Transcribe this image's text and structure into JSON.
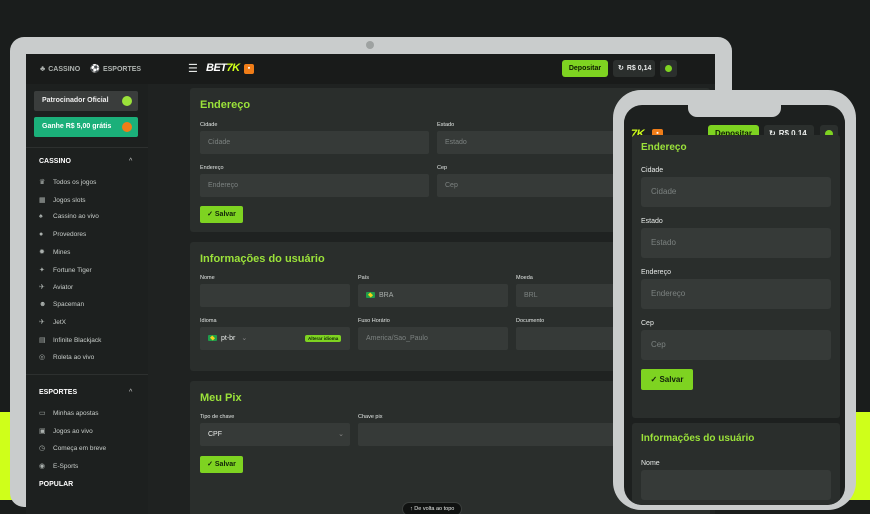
{
  "topbar": {
    "casino": "CASSINO",
    "esportes": "ESPORTES",
    "logo_main": "BET",
    "logo_accent": "7K",
    "deposit_label": "Depositar",
    "balance": "R$ 0,14"
  },
  "sidebar": {
    "promo_sponsor": "Patrocinador Oficial",
    "promo_bonus": "Ganhe R$ 5,00 grátis",
    "casino_header": "CASSINO",
    "casino_items": [
      "Todos os jogos",
      "Jogos slots",
      "Cassino ao vivo",
      "Provedores",
      "Mines",
      "Fortune Tiger",
      "Aviator",
      "Spaceman",
      "JetX",
      "Infinite Blackjack",
      "Roleta ao vivo"
    ],
    "sports_header": "ESPORTES",
    "sports_items": [
      "Minhas apostas",
      "Jogos ao vivo",
      "Começa em breve",
      "E-Sports"
    ],
    "popular_header": "POPULAR"
  },
  "address": {
    "title": "Endereço",
    "cidade_label": "Cidade",
    "cidade_placeholder": "Cidade",
    "estado_label": "Estado",
    "estado_placeholder": "Estado",
    "endereco_label": "Endereço",
    "endereco_placeholder": "Endereço",
    "cep_label": "Cep",
    "cep_placeholder": "Cep",
    "save_label": "Salvar"
  },
  "user_info": {
    "title": "Informações do usuário",
    "nome_label": "Nome",
    "pais_label": "País",
    "pais_value": "BRA",
    "moeda_label": "Moeda",
    "moeda_value": "BRL",
    "idioma_label": "Idioma",
    "idioma_value": "pt-br",
    "alterar_label": "Alterar idioma",
    "fuso_label": "Fuso Horário",
    "fuso_value": "America/Sao_Paulo",
    "documento_label": "Documento"
  },
  "pix": {
    "title": "Meu Pix",
    "tipo_label": "Tipo de chave",
    "tipo_value": "CPF",
    "chave_label": "Chave pix",
    "save_label": "Salvar"
  },
  "back_to_top": "De volta ao topo",
  "colors": {
    "accent": "#7ed321",
    "title_green": "#9be23a",
    "brand_lime": "#cfff1a"
  }
}
